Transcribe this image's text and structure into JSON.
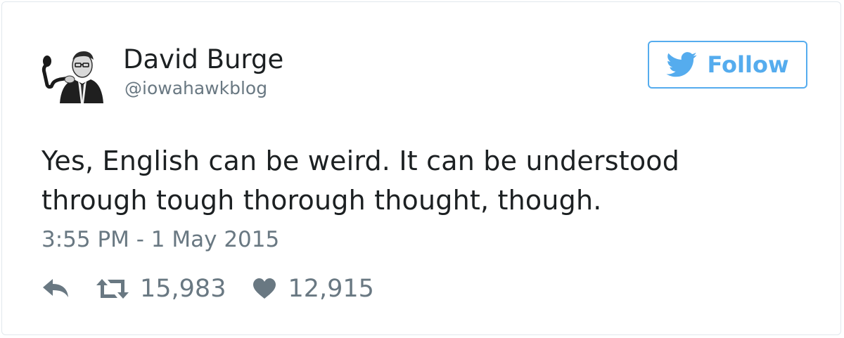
{
  "author": {
    "name": "David Burge",
    "handle": "@iowahawkblog"
  },
  "follow_button": {
    "label": "Follow",
    "icon": "twitter-bird-icon",
    "color": "#55acee"
  },
  "tweet": {
    "lines": [
      "Yes, English can be weird. It can be understood",
      "through tough thorough thought, though."
    ],
    "timestamp": "3:55 PM - 1 May 2015"
  },
  "actions": {
    "reply": {
      "icon": "reply-icon"
    },
    "retweet": {
      "icon": "retweet-icon",
      "count": "15,983"
    },
    "like": {
      "icon": "heart-icon",
      "count": "12,915"
    }
  },
  "colors": {
    "text": "#1c2022",
    "muted": "#697882",
    "accent": "#55acee",
    "border": "#e1e8ed"
  }
}
